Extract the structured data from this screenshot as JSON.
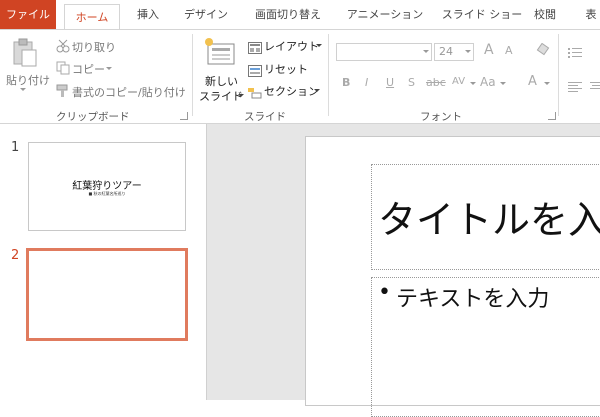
{
  "tabs": [
    {
      "label": "ファイル"
    },
    {
      "label": "ホーム"
    },
    {
      "label": "挿入"
    },
    {
      "label": "デザイン"
    },
    {
      "label": "画面切り替え"
    },
    {
      "label": "アニメーション"
    },
    {
      "label": "スライド ショー"
    },
    {
      "label": "校閲"
    },
    {
      "label": "表"
    }
  ],
  "clipboard": {
    "paste_label": "貼り付け",
    "cut_label": "切り取り",
    "copy_label": "コピー",
    "format_painter_label": "書式のコピー/貼り付け",
    "group_label": "クリップボード"
  },
  "slides_group": {
    "new_slide_line1": "新しい",
    "new_slide_line2": "スライド",
    "layout_label": "レイアウト",
    "reset_label": "リセット",
    "section_label": "セクション",
    "group_label": "スライド"
  },
  "font": {
    "size_value": "24",
    "grow_label": "A",
    "shrink_label": "A",
    "bold": "B",
    "italic": "I",
    "underline": "U",
    "shadow": "S",
    "strike": "abc",
    "spacing": "AV",
    "case": "Aa",
    "color": "A",
    "group_label": "フォント"
  },
  "thumbnails": [
    {
      "number": "1",
      "title": "紅葉狩りツアー",
      "subtitle": "■ 秋の紅葉名所巡り"
    },
    {
      "number": "2"
    }
  ],
  "slide": {
    "title_placeholder": "タイトルを入",
    "bullet": "•",
    "text_placeholder": "テキストを入力"
  },
  "colors": {
    "accent": "#d04423",
    "selected_thumb_border": "#e07b5e",
    "workarea_bg": "#e6e6e6"
  }
}
